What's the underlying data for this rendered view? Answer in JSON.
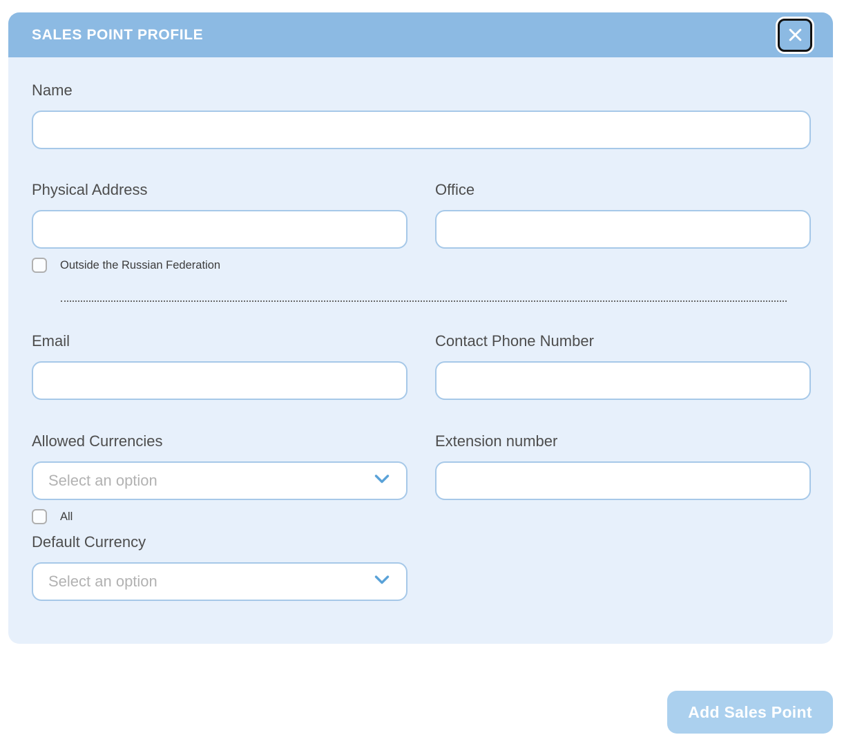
{
  "modal": {
    "title": "SALES POINT PROFILE"
  },
  "fields": {
    "name": {
      "label": "Name",
      "value": ""
    },
    "physical_address": {
      "label": "Physical Address",
      "value": ""
    },
    "office": {
      "label": "Office",
      "value": ""
    },
    "outside_rf": {
      "label": "Outside the Russian Federation",
      "checked": false
    },
    "email": {
      "label": "Email",
      "value": ""
    },
    "contact_phone": {
      "label": "Contact Phone Number",
      "value": ""
    },
    "allowed_currencies": {
      "label": "Allowed Currencies",
      "value": "Select an option"
    },
    "all": {
      "label": "All",
      "checked": false
    },
    "extension_number": {
      "label": "Extension number",
      "value": ""
    },
    "default_currency": {
      "label": "Default Currency",
      "value": "Select an option"
    }
  },
  "actions": {
    "add_button": "Add Sales Point"
  },
  "icons": {
    "close": "close-icon",
    "chevron": "chevron-down-icon"
  },
  "colors": {
    "header_blue": "#8cbae3",
    "body_blue": "#e7f0fb",
    "input_border": "#a6c8e8",
    "button_blue": "#abd0ee",
    "chevron_blue": "#5aa2d8"
  }
}
